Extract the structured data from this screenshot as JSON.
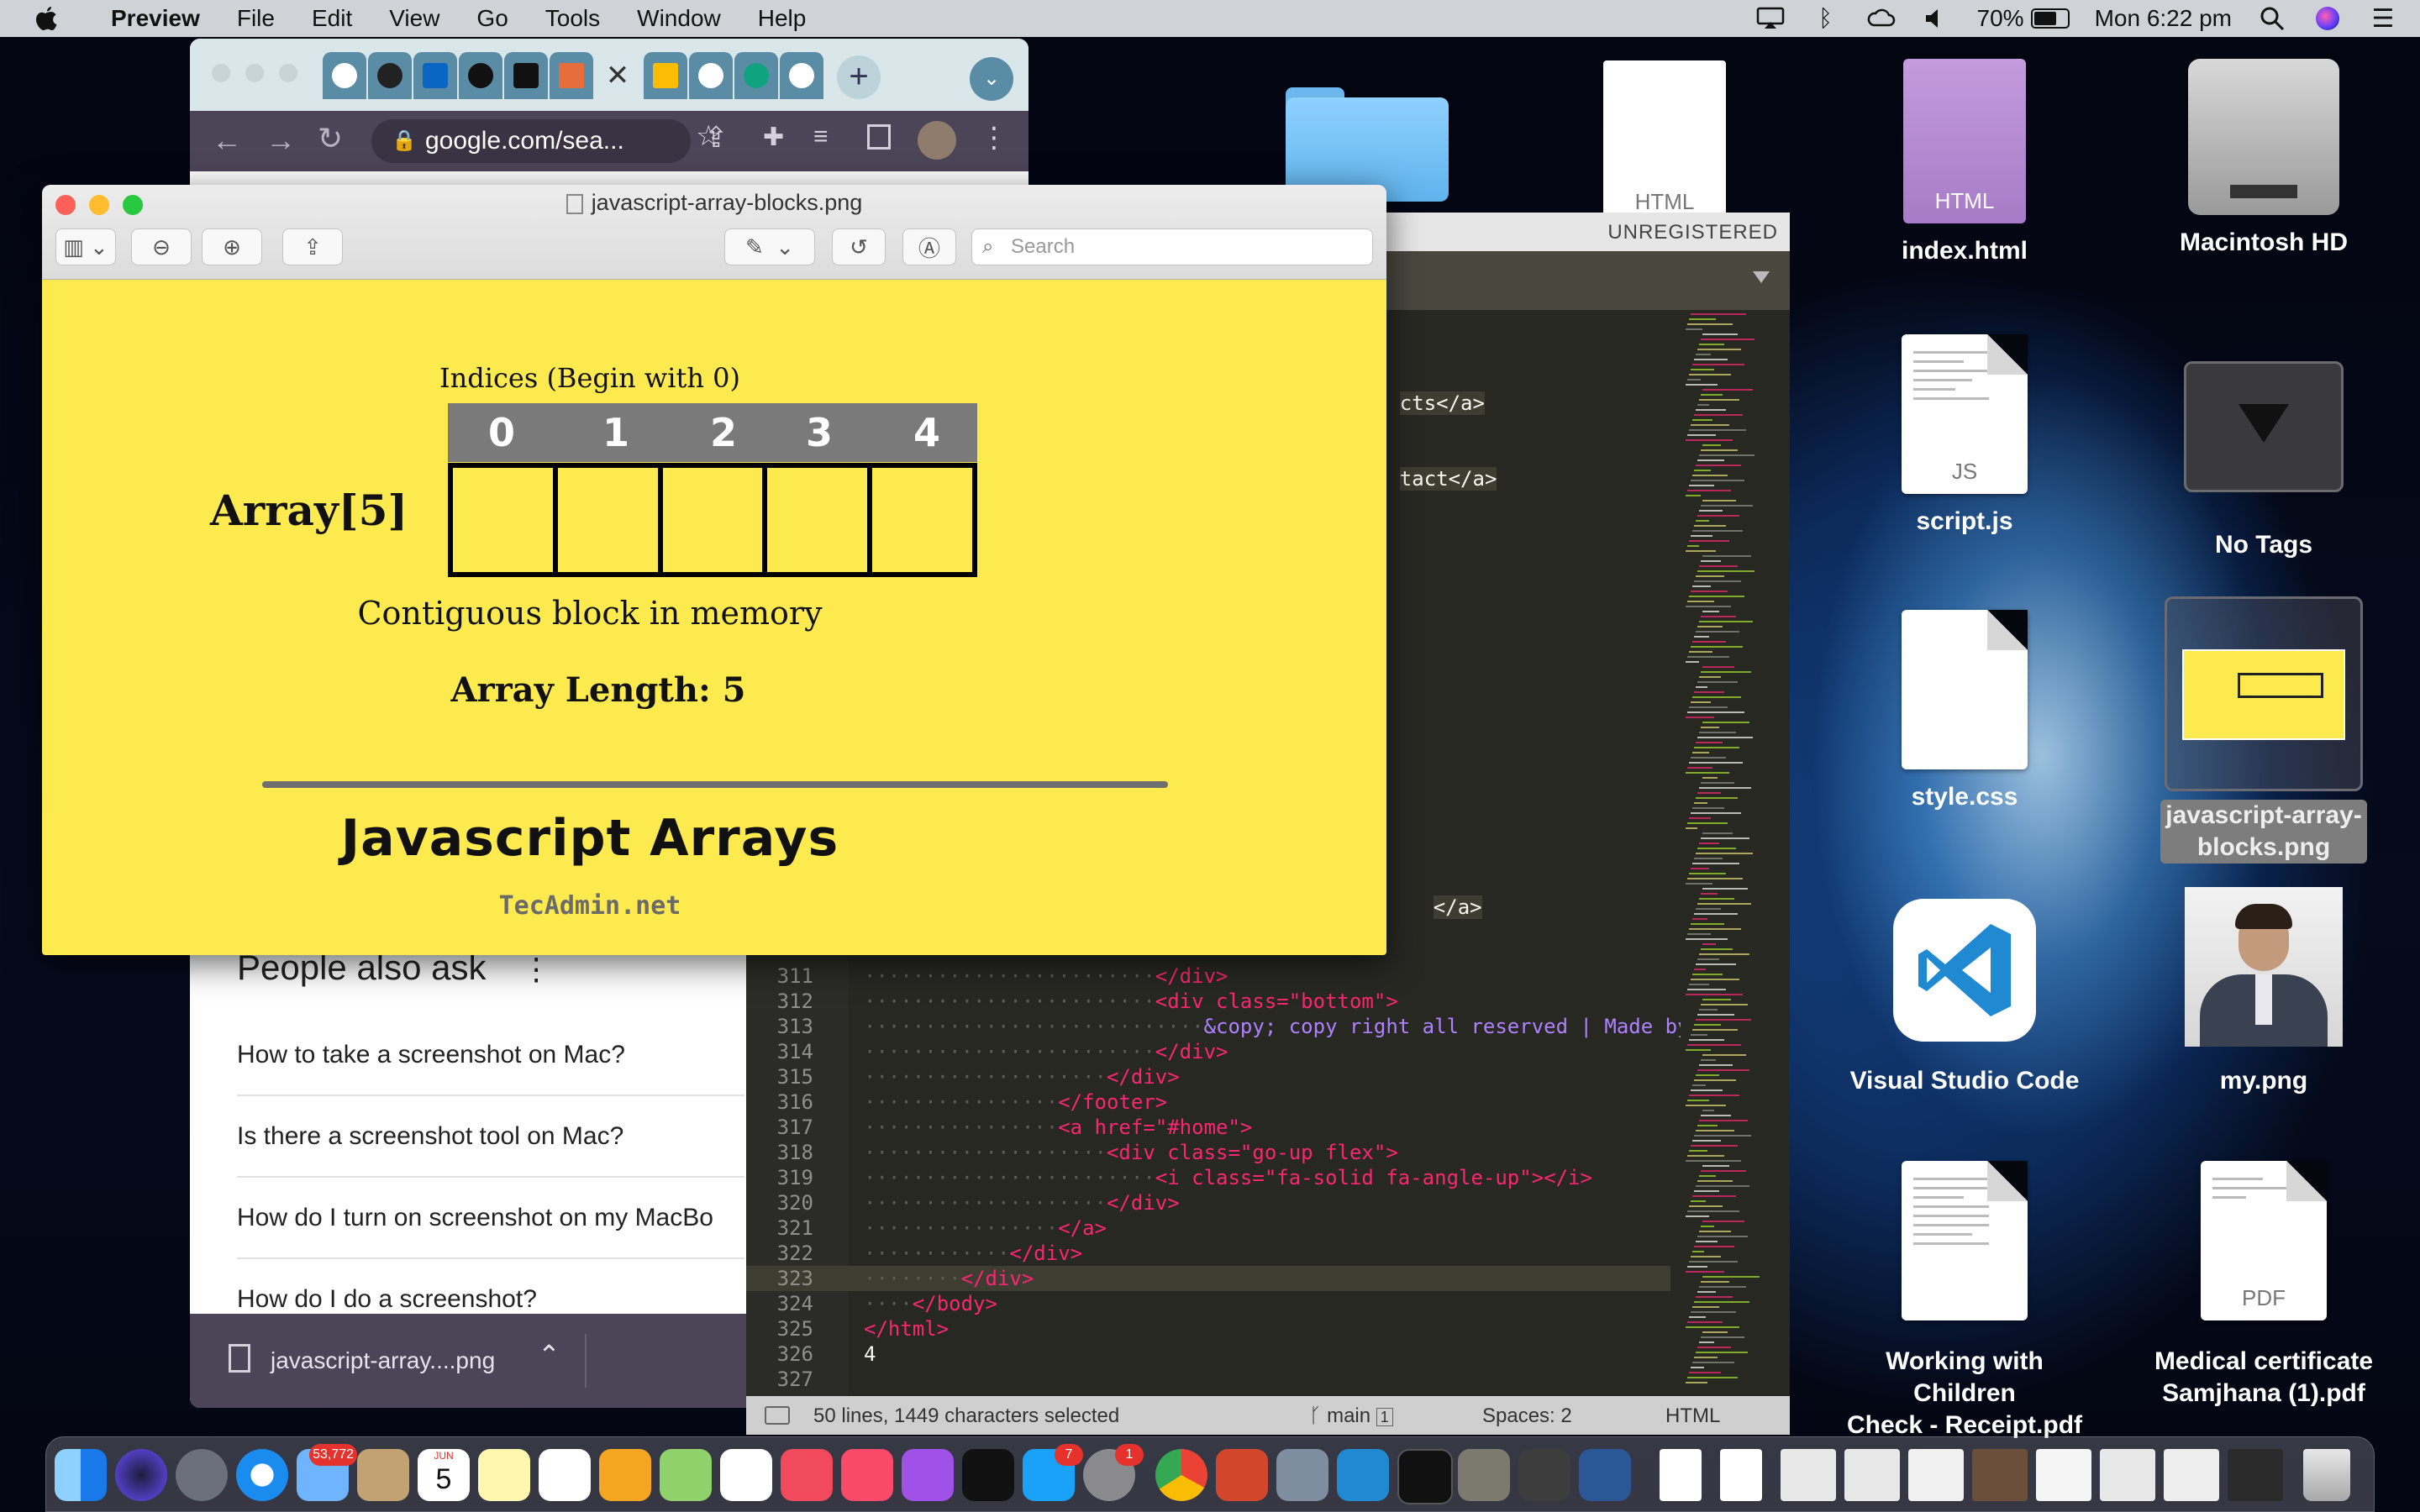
{
  "menubar": {
    "app": "Preview",
    "items": [
      "File",
      "Edit",
      "View",
      "Go",
      "Tools",
      "Window",
      "Help"
    ],
    "battery": "70%",
    "clock": "Mon 6:22 pm"
  },
  "desktop": {
    "icons": [
      {
        "label": "index.html",
        "type": "HTML"
      },
      {
        "label": "Macintosh HD",
        "type": "drive"
      },
      {
        "label": "script.js",
        "type": "JS"
      },
      {
        "label": "No Tags",
        "type": "tag"
      },
      {
        "label": "style.css",
        "type": "css"
      },
      {
        "label": "javascript-array-blocks.png",
        "type": "png",
        "label_line1": "javascript-array-",
        "label_line2": "blocks.png"
      },
      {
        "label": "Visual Studio Code",
        "type": "app"
      },
      {
        "label": "my.png",
        "type": "png"
      },
      {
        "label": "Working with Children Check - Receipt.pdf",
        "label_line1": "Working with Children",
        "label_line2": "Check - Receipt.pdf",
        "type": "pdf"
      },
      {
        "label": "Medical certificate Samjhana (1).pdf",
        "label_line1": "Medical certificate",
        "label_line2": "Samjhana (1).pdf",
        "type": "PDF"
      }
    ],
    "top_partial_doc_ext": "HTML"
  },
  "chrome": {
    "url": "google.com/sea...",
    "people_also_ask": "People also ask",
    "questions": [
      "How to take a screenshot on Mac?",
      "Is there a screenshot tool on Mac?",
      "How do I turn on screenshot on my MacBo",
      "How do I do a screenshot?"
    ],
    "download_name": "javascript-array....png"
  },
  "preview": {
    "filename": "javascript-array-blocks.png",
    "search_placeholder": "Search",
    "image": {
      "indices_title": "Indices (Begin with 0)",
      "indices": [
        "0",
        "1",
        "2",
        "3",
        "4"
      ],
      "array_label": "Array[5]",
      "contiguous": "Contiguous block in memory",
      "array_length": "Array Length: 5",
      "heading": "Javascript Arrays",
      "credit": "TecAdmin.net"
    }
  },
  "sublime": {
    "unregistered": "UNREGISTERED",
    "partial_lines": [
      "cts</a>",
      "tact</a>",
      "</a>"
    ],
    "lines": [
      {
        "n": "311",
        "code": "</div>"
      },
      {
        "n": "312",
        "code": "<div class=\"bottom\">"
      },
      {
        "n": "313",
        "code": "&copy; copy right all reserved | Made by myself"
      },
      {
        "n": "314",
        "code": "</div>"
      },
      {
        "n": "315",
        "code": "</div>"
      },
      {
        "n": "316",
        "code": "</footer>"
      },
      {
        "n": "317",
        "code": "<a href=\"#home\">"
      },
      {
        "n": "318",
        "code": "<div class=\"go-up flex\">"
      },
      {
        "n": "319",
        "code": "<i class=\"fa-solid fa-angle-up\"></i>"
      },
      {
        "n": "320",
        "code": "</div>"
      },
      {
        "n": "321",
        "code": "</a>"
      },
      {
        "n": "322",
        "code": "</div>"
      },
      {
        "n": "323",
        "code": "</div>"
      },
      {
        "n": "324",
        "code": "</body>"
      },
      {
        "n": "325",
        "code": "</html>"
      },
      {
        "n": "326",
        "code": "4"
      },
      {
        "n": "327",
        "code": ""
      }
    ],
    "status_left": "50 lines, 1449 characters selected",
    "branch": "main",
    "branch_count": "1",
    "spaces": "Spaces: 2",
    "syntax": "HTML"
  },
  "dock": {
    "mail_badge": "53,772",
    "calendar_month": "JUN",
    "calendar_day": "5",
    "appstore_badge": "7",
    "settings_badge": "1"
  },
  "colors": {
    "yellow": "#fdea4e",
    "monokai_bg": "#272822",
    "tag": "#f92672",
    "attr": "#a6e22e",
    "string": "#e6db74"
  }
}
